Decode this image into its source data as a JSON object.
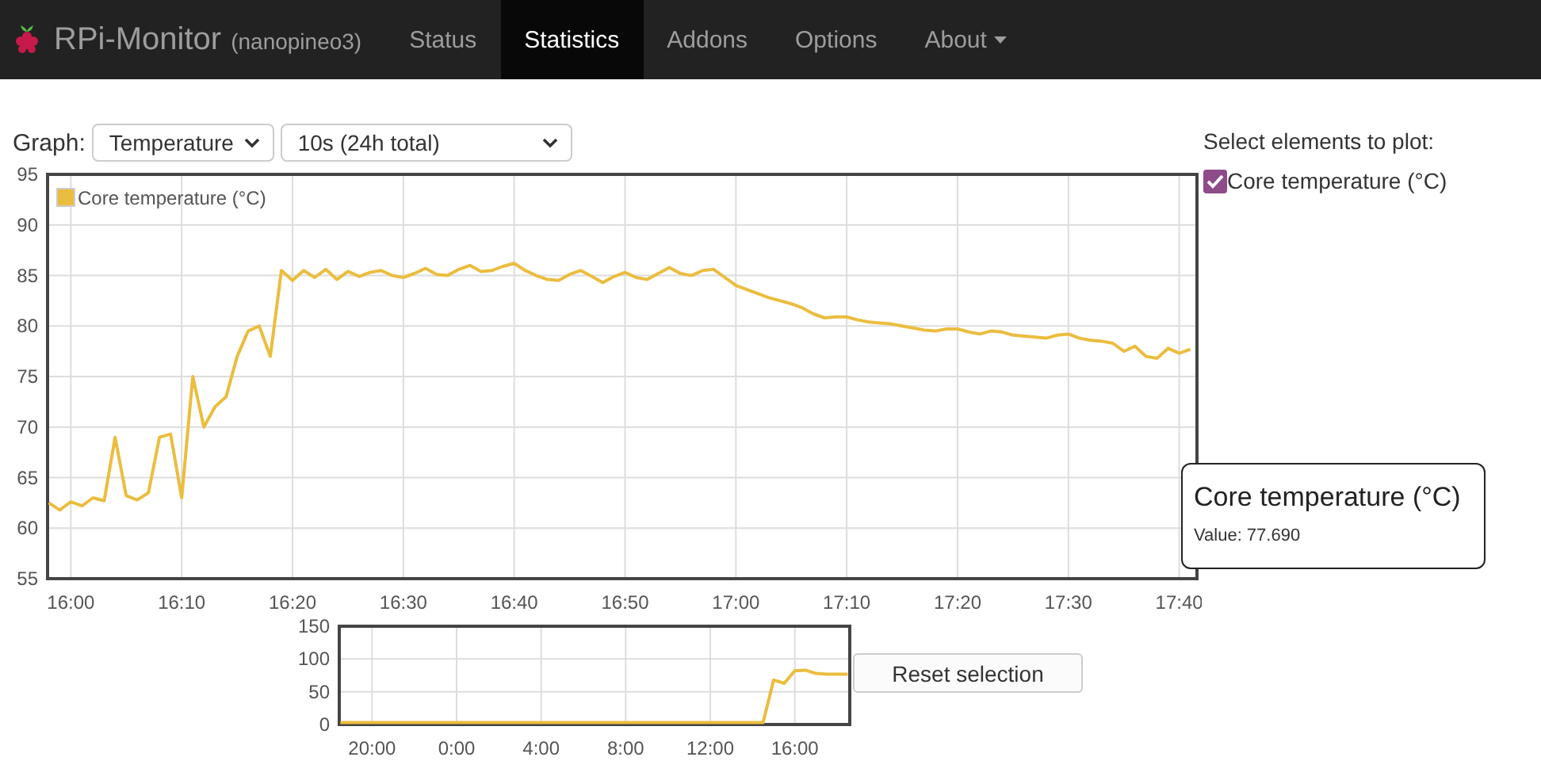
{
  "navbar": {
    "brand": "RPi-Monitor",
    "host": "(nanopineo3)",
    "items": [
      {
        "label": "Status",
        "selected": false,
        "dropdown": false
      },
      {
        "label": "Statistics",
        "selected": true,
        "dropdown": false
      },
      {
        "label": "Addons",
        "selected": false,
        "dropdown": false
      },
      {
        "label": "Options",
        "selected": false,
        "dropdown": false
      },
      {
        "label": "About",
        "selected": false,
        "dropdown": true
      }
    ]
  },
  "controls": {
    "label": "Graph:",
    "graph": "Temperature",
    "period": "10s (24h total)"
  },
  "main_chart": {
    "chart_data": {
      "type": "line",
      "grid": true,
      "ylim": [
        55,
        95
      ],
      "categories": [
        null,
        null,
        "16:00",
        null,
        null,
        null,
        null,
        null,
        null,
        null,
        null,
        null,
        "16:10",
        null,
        null,
        null,
        null,
        null,
        null,
        null,
        null,
        null,
        "16:20",
        null,
        null,
        null,
        null,
        null,
        null,
        null,
        null,
        null,
        "16:30",
        null,
        null,
        null,
        null,
        null,
        null,
        null,
        null,
        null,
        "16:40",
        null,
        null,
        null,
        null,
        null,
        null,
        null,
        null,
        null,
        "16:50",
        null,
        null,
        null,
        null,
        null,
        null,
        null,
        null,
        null,
        "17:00",
        null,
        null,
        null,
        null,
        null,
        null,
        null,
        null,
        null,
        "17:10",
        null,
        null,
        null,
        null,
        null,
        null,
        null,
        null,
        null,
        "17:20",
        null,
        null,
        null,
        null,
        null,
        null,
        null,
        null,
        null,
        "17:30",
        null,
        null,
        null,
        null,
        null,
        null,
        null,
        null,
        null,
        "17:40",
        null
      ],
      "yticks": [
        55,
        60,
        65,
        70,
        75,
        80,
        85,
        90,
        95
      ],
      "series": [
        {
          "name": "Core temperature (°C)",
          "color": "#ebbd3f",
          "values": [
            62.5,
            61.8,
            62.6,
            62.2,
            63,
            62.7,
            69,
            63.2,
            62.8,
            63.5,
            69,
            69.3,
            63,
            75,
            70,
            72,
            73,
            77,
            79.5,
            80,
            77,
            85.5,
            84.5,
            85.5,
            84.8,
            85.6,
            84.6,
            85.4,
            84.9,
            85.3,
            85.5,
            85,
            84.8,
            85.2,
            85.7,
            85.1,
            85,
            85.6,
            86,
            85.4,
            85.5,
            85.9,
            86.2,
            85.5,
            85,
            84.6,
            84.5,
            85.1,
            85.5,
            84.9,
            84.3,
            84.9,
            85.3,
            84.8,
            84.6,
            85.2,
            85.8,
            85.2,
            85,
            85.5,
            85.6,
            84.8,
            84,
            83.6,
            83.2,
            82.8,
            82.5,
            82.2,
            81.8,
            81.2,
            80.8,
            80.9,
            80.9,
            80.6,
            80.4,
            80.3,
            80.2,
            80,
            79.8,
            79.6,
            79.5,
            79.7,
            79.7,
            79.4,
            79.2,
            79.5,
            79.4,
            79.1,
            79,
            78.9,
            78.8,
            79.1,
            79.2,
            78.8,
            78.6,
            78.5,
            78.3,
            77.5,
            78,
            77,
            76.8,
            77.8,
            77.3,
            77.7
          ]
        }
      ]
    },
    "tooltip": {
      "title": "Core temperature (°C)",
      "value": "Value: 77.690"
    }
  },
  "overview_chart": {
    "chart_data": {
      "type": "line",
      "grid": true,
      "ylim": [
        0,
        150
      ],
      "categories": [
        null,
        null,
        null,
        "20:00",
        null,
        null,
        null,
        null,
        null,
        null,
        null,
        "0:00",
        null,
        null,
        null,
        null,
        null,
        null,
        null,
        "4:00",
        null,
        null,
        null,
        null,
        null,
        null,
        null,
        "8:00",
        null,
        null,
        null,
        null,
        null,
        null,
        null,
        "12:00",
        null,
        null,
        null,
        null,
        null,
        null,
        null,
        "16:00",
        null,
        null,
        null,
        null,
        null
      ],
      "yticks": [
        0,
        50,
        100,
        150
      ],
      "series": [
        {
          "color": "#ebbd3f",
          "values": [
            3,
            3,
            3,
            3,
            3,
            3,
            3,
            3,
            3,
            3,
            3,
            3,
            3,
            3,
            3,
            3,
            3,
            3,
            3,
            3,
            3,
            3,
            3,
            3,
            3,
            3,
            3,
            3,
            3,
            3,
            3,
            3,
            3,
            3,
            3,
            3,
            3,
            3,
            3,
            3,
            3,
            68,
            63,
            82,
            83,
            78,
            77,
            77,
            77
          ]
        }
      ]
    }
  },
  "reset_button": "Reset selection",
  "plot_panel": {
    "title": "Select elements to plot:",
    "elements": [
      {
        "label": "Core temperature (°C)",
        "checked": true
      }
    ]
  }
}
